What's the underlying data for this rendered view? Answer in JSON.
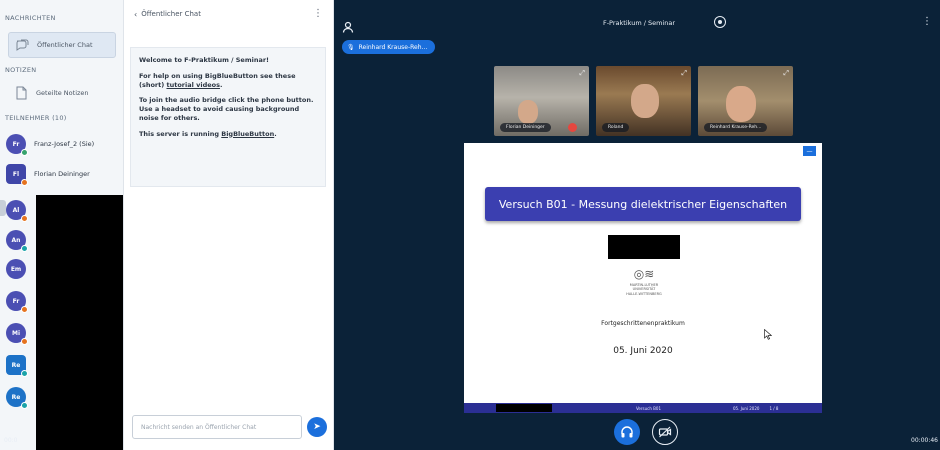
{
  "userlist": {
    "messages_title": "NACHRICHTEN",
    "public_chat": "Öffentlicher Chat",
    "notes_title": "NOTIZEN",
    "shared_notes": "Geteilte Notizen",
    "participants_title": "TEILNEHMER (10)",
    "users": [
      {
        "initials": "Fr",
        "name": "Franz-Josef_2 (Sie)",
        "status": "green",
        "square": false
      },
      {
        "initials": "Fl",
        "name": "Florian Deininger",
        "status": "orange",
        "square": true
      },
      {
        "initials": "Al",
        "name": "",
        "status": "orange",
        "square": false
      },
      {
        "initials": "An",
        "name": "",
        "status": "teal",
        "square": false
      },
      {
        "initials": "Em",
        "name": "",
        "status": "",
        "square": false
      },
      {
        "initials": "Fr",
        "name": "",
        "status": "orange",
        "square": false
      },
      {
        "initials": "Mi",
        "name": "",
        "status": "orange",
        "square": false
      },
      {
        "initials": "Re",
        "name": "",
        "status": "teal",
        "square": false
      },
      {
        "initials": "Re",
        "name": "",
        "status": "teal",
        "square": false
      }
    ],
    "time": "00:0"
  },
  "chat": {
    "header": "Öffentlicher Chat",
    "welcome_title": "Welcome to F-Praktikum / Seminar!",
    "help_text": "For help on using BigBlueButton see these (short)",
    "help_link": "tutorial videos",
    "audio_text": "To join the audio bridge click the phone button. Use a headset to avoid causing background noise for others.",
    "server_text": "This server is running",
    "server_link": "BigBlueButton",
    "input_placeholder": "Nachricht senden an Öffentlicher Chat"
  },
  "main": {
    "title": "F-Praktikum / Seminar",
    "talker": "Reinhard Krause-Reh...",
    "cams": [
      {
        "label": "Florian Deininger"
      },
      {
        "label": "Roland"
      },
      {
        "label": "Reinhard Krause-Reh..."
      }
    ],
    "slide": {
      "title": "Versuch B01 - Messung dielektrischer Eigenschaften",
      "university_lines": [
        "MARTIN-LUTHER",
        "UNIVERSITÄT",
        "HALLE-WITTENBERG"
      ],
      "subtitle": "Fortgeschrittenenpraktikum",
      "date": "05. Juni 2020",
      "footer_center": "Versuch B01",
      "footer_date": "05. Juni 2020",
      "footer_page": "1 / 8"
    },
    "time": "00:00:46"
  }
}
